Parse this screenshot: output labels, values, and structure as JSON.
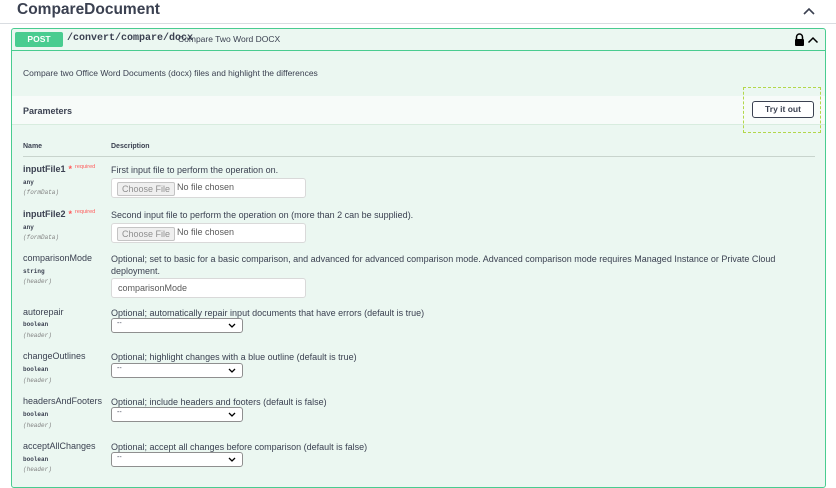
{
  "tag": {
    "title": "CompareDocument"
  },
  "operation": {
    "method": "POST",
    "path": "/convert/compare/docx",
    "summary": "Compare Two Word DOCX",
    "description": "Compare two Office Word Documents (docx) files and highlight the differences"
  },
  "parameters": {
    "title": "Parameters",
    "try_label": "Try it out",
    "col_name": "Name",
    "col_description": "Description",
    "required_label": "required",
    "required_star": "*",
    "items": [
      {
        "name": "inputFile1",
        "type": "any",
        "in": "(formData)",
        "description": "First input file to perform the operation on.",
        "choose_label": "Choose File",
        "file_status": "No file chosen"
      },
      {
        "name": "inputFile2",
        "type": "any",
        "in": "(formData)",
        "description": "Second input file to perform the operation on (more than 2 can be supplied).",
        "choose_label": "Choose File",
        "file_status": "No file chosen"
      },
      {
        "name": "comparisonMode",
        "type": "string",
        "in": "(header)",
        "description": "Optional; set to basic for a basic comparison, and advanced for advanced comparison mode. Advanced comparison mode requires Managed Instance or Private Cloud deployment.",
        "placeholder": "comparisonMode"
      },
      {
        "name": "autorepair",
        "type": "boolean",
        "in": "(header)",
        "description": "Optional; automatically repair input documents that have errors (default is true)",
        "value": "--"
      },
      {
        "name": "changeOutlines",
        "type": "boolean",
        "in": "(header)",
        "description": "Optional; highlight changes with a blue outline (default is true)",
        "value": "--"
      },
      {
        "name": "headersAndFooters",
        "type": "boolean",
        "in": "(header)",
        "description": "Optional; include headers and footers (default is false)",
        "value": "--"
      },
      {
        "name": "acceptAllChanges",
        "type": "boolean",
        "in": "(header)",
        "description": "Optional; accept all changes before comparison (default is false)",
        "value": "--"
      }
    ]
  },
  "colors": {
    "post": "#49cc90",
    "post_bg": "#ebf7f1",
    "required": "#ff5a5a",
    "highlight": "#b3d74a"
  }
}
